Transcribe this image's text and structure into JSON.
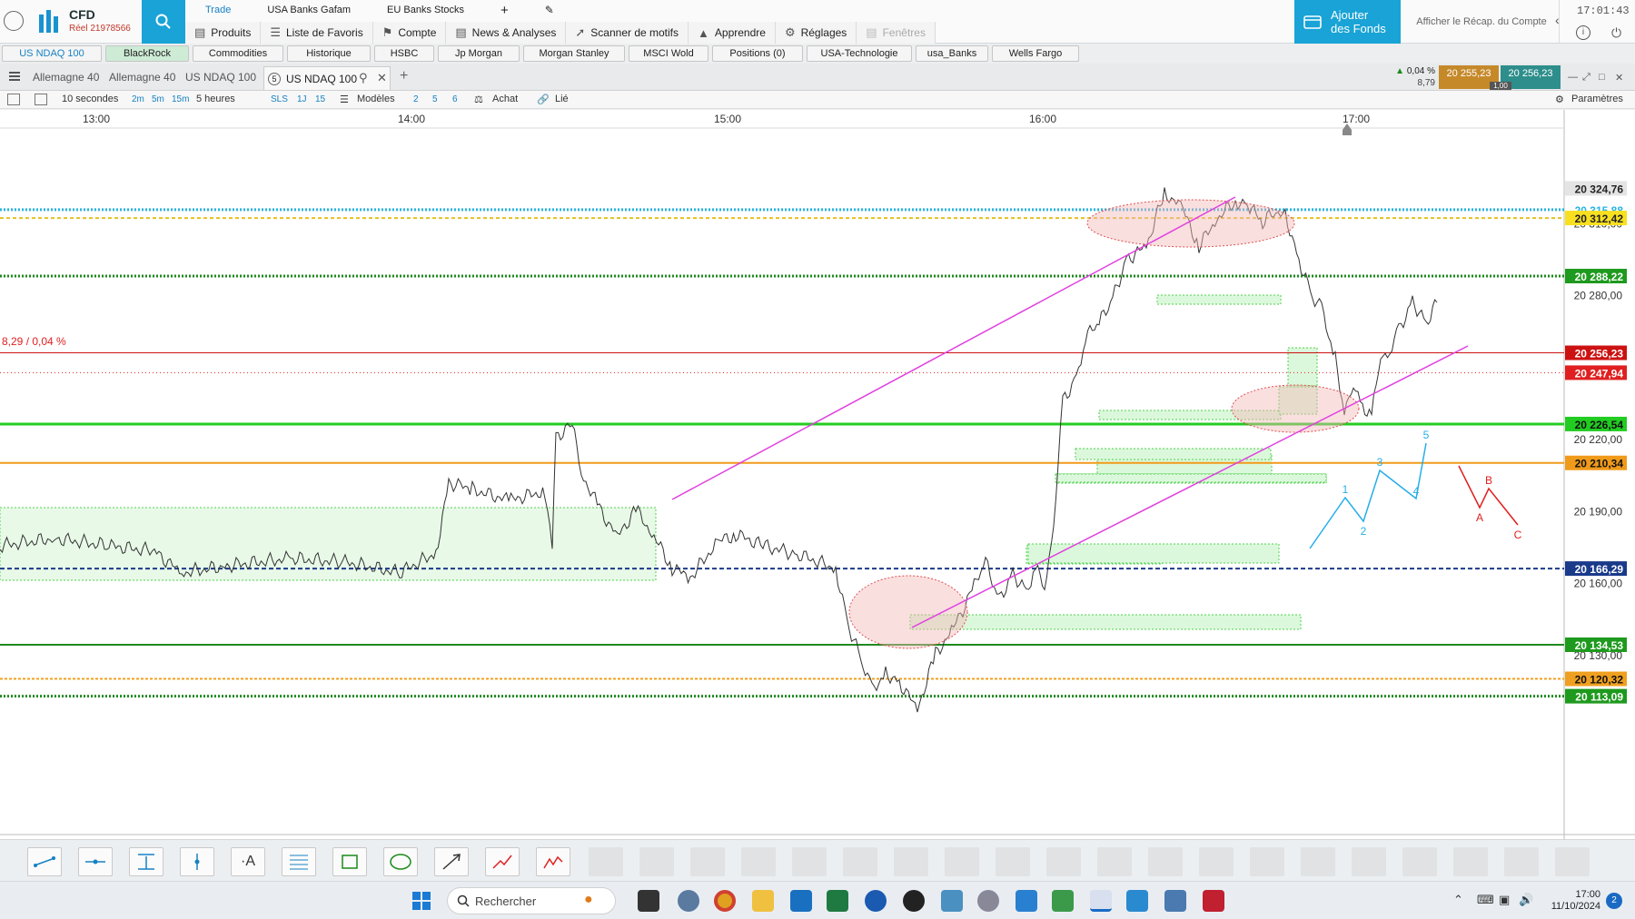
{
  "header": {
    "product": "CFD",
    "account": "Réel 21978566",
    "nav_top": [
      "Trade",
      "USA Banks Gafam",
      "EU Banks Stocks"
    ],
    "nav_main": [
      {
        "label": "Produits",
        "icon": "document-icon"
      },
      {
        "label": "Liste de Favoris",
        "icon": "list-icon"
      },
      {
        "label": "Compte",
        "icon": "tag-icon"
      },
      {
        "label": "News & Analyses",
        "icon": "news-icon"
      },
      {
        "label": "Scanner de motifs",
        "icon": "scanner-icon"
      },
      {
        "label": "Apprendre",
        "icon": "graduation-cap-icon"
      },
      {
        "label": "Réglages",
        "icon": "gear-icon"
      },
      {
        "label": "Fenêtres",
        "icon": "windows-icon"
      }
    ],
    "fund_button": [
      "Ajouter",
      "des Fonds"
    ],
    "recap": "Afficher le Récap. du Compte",
    "clock": "17:01:43"
  },
  "watchlist_tabs": [
    "US NDAQ 100",
    "BlackRock",
    "Commodities",
    "Historique",
    "HSBC",
    "Jp Morgan",
    "Morgan Stanley",
    "MSCI Wold",
    "Positions (0)",
    "USA-Technologie",
    "usa_Banks",
    "Wells Fargo"
  ],
  "chart_tabs": {
    "inactive": [
      "Allemagne 40",
      "Allemagne 40",
      "US NDAQ 100"
    ],
    "active_num": "5",
    "active": "US NDAQ 100"
  },
  "quote": {
    "change_pct": "0,04 %",
    "change_amt": "8,79",
    "bid": "20 255,23",
    "ask": "20 256,23",
    "spread": "1,00"
  },
  "toolbar": {
    "interval": "10 secondes",
    "tf": [
      "2m",
      "5m",
      "15m"
    ],
    "range": "5 heures",
    "sls": "SLS",
    "tf2": [
      "1J",
      "15"
    ],
    "models": "Modèles",
    "nums": [
      "2",
      "5",
      "6"
    ],
    "buy": "Achat",
    "linked": "Lié",
    "params": "Paramètres"
  },
  "chart_data": {
    "type": "line",
    "x_ticks": [
      "13:00",
      "14:00",
      "15:00",
      "16:00",
      "17:00"
    ],
    "y_ticks": [
      "20 310,00",
      "20 280,00",
      "20 220,00",
      "20 190,00",
      "20 160,00",
      "20 130,00"
    ],
    "ylim": [
      20108,
      20330
    ],
    "levels": [
      {
        "label": "20 324,76",
        "value": 20324.76,
        "color": "#555555"
      },
      {
        "label": "20 315,88",
        "value": 20315.88,
        "color": "#28b4e0"
      },
      {
        "label": "20 312,42",
        "value": 20312.42,
        "color": "#e6c020"
      },
      {
        "label": "20 288,22",
        "value": 20288.22,
        "color": "#1e8a1e"
      },
      {
        "label": "20 256,23",
        "value": 20256.23,
        "color": "#cc1111"
      },
      {
        "label": "20 247,94",
        "value": 20247.94,
        "color": "#e02020"
      },
      {
        "label": "20 226,54",
        "value": 20226.54,
        "color": "#22cc22"
      },
      {
        "label": "20 210,34",
        "value": 20210.34,
        "color": "#f09a1a"
      },
      {
        "label": "20 166,29",
        "value": 20166.29,
        "color": "#1a3a8a"
      },
      {
        "label": "20 134,53",
        "value": 20134.53,
        "color": "#1e8a1e"
      },
      {
        "label": "20 120,32",
        "value": 20120.32,
        "color": "#f0a020"
      },
      {
        "label": "20 113,09",
        "value": 20113.09,
        "color": "#1e8a1e"
      }
    ],
    "pl_label": "8,29 / 0,04 %",
    "wave_up": [
      "1",
      "2",
      "3",
      "4",
      "5"
    ],
    "wave_down": [
      "A",
      "B",
      "C"
    ]
  },
  "draw_tools": [
    "line-tool-icon",
    "horizontal-line-tool-icon",
    "text-marker-tool-icon",
    "vertical-line-tool-icon",
    "text-tool-icon",
    "fibonacci-tool-icon",
    "rectangle-tool-icon",
    "ellipse-tool-icon",
    "arrow-tool-icon",
    "polyline-tool-icon",
    "pattern-tool-icon"
  ],
  "taskbar": {
    "search": "Rechercher",
    "time": "17:00",
    "date": "11/10/2024",
    "notifications": "2"
  }
}
